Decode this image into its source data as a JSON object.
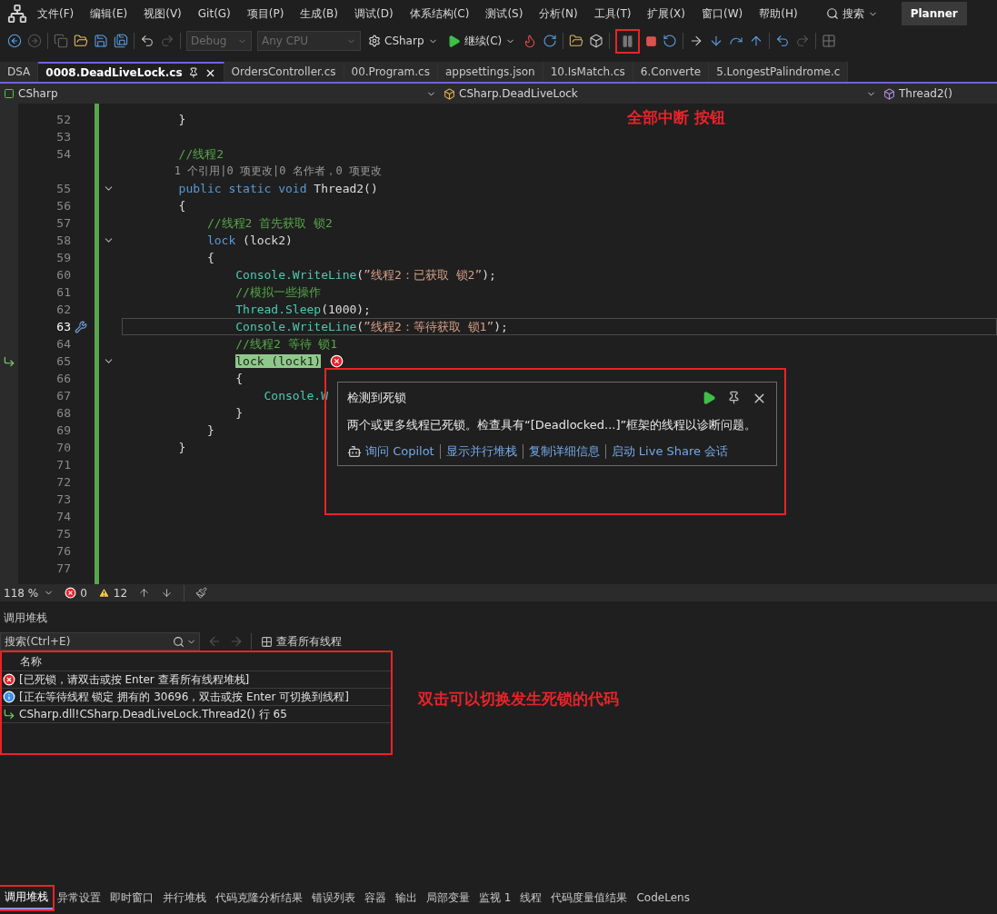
{
  "menu": {
    "items": [
      "文件(F)",
      "编辑(E)",
      "视图(V)",
      "Git(G)",
      "项目(P)",
      "生成(B)",
      "调试(D)",
      "体系结构(C)",
      "测试(S)",
      "分析(N)",
      "工具(T)",
      "扩展(X)",
      "窗口(W)",
      "帮助(H)"
    ],
    "search": "搜索",
    "account_button": "Planner"
  },
  "toolbar": {
    "configuration": {
      "value": "Debug",
      "disabled": true
    },
    "platform": {
      "value": "Any CPU",
      "disabled": true
    },
    "startup_project": "CSharp",
    "continue_button": "继续(C)",
    "break_all": {
      "annotated": true,
      "note": "全部中断 按钮"
    }
  },
  "tabs": [
    {
      "label": "DSA",
      "selected": false
    },
    {
      "label": "0008.DeadLiveLock.cs",
      "selected": true
    },
    {
      "label": "OrdersController.cs",
      "selected": false
    },
    {
      "label": "00.Program.cs",
      "selected": false
    },
    {
      "label": "appsettings.json",
      "selected": false
    },
    {
      "label": "10.IsMatch.cs",
      "selected": false
    },
    {
      "label": "6.Converte",
      "selected": false
    },
    {
      "label": "5.LongestPalindrome.c",
      "selected": false
    }
  ],
  "navigation": {
    "project": "CSharp",
    "type": "CSharp.DeadLiveLock",
    "member": "Thread2()"
  },
  "code_lines": [
    {
      "number": "52",
      "fold": false,
      "caret": false,
      "quick_action": false,
      "current_thread": false,
      "error": false,
      "segments": [
        {
          "kind": "plain",
          "text": "        }"
        }
      ]
    },
    {
      "number": "53",
      "fold": false,
      "caret": false,
      "quick_action": false,
      "current_thread": false,
      "error": false
    },
    {
      "number": "54",
      "fold": false,
      "caret": false,
      "quick_action": false,
      "current_thread": false,
      "error": false,
      "segments": [
        {
          "kind": "comment",
          "text": "        //线程2"
        }
      ]
    },
    {
      "kind": "codelens",
      "text": "        1 个引用|0 项更改|0 名作者，0 项更改"
    },
    {
      "number": "55",
      "fold": true,
      "caret": false,
      "quick_action": false,
      "current_thread": false,
      "error": false,
      "segments": [
        {
          "kind": "keyword",
          "text": "        public static void "
        },
        {
          "kind": "plain",
          "text": "Thread2()"
        }
      ]
    },
    {
      "number": "56",
      "fold": false,
      "caret": false,
      "quick_action": false,
      "current_thread": false,
      "error": false,
      "segments": [
        {
          "kind": "plain",
          "text": "        {"
        }
      ]
    },
    {
      "number": "57",
      "fold": false,
      "caret": false,
      "quick_action": false,
      "current_thread": false,
      "error": false,
      "segments": [
        {
          "kind": "comment",
          "text": "            //线程2 首先获取 锁2"
        }
      ]
    },
    {
      "number": "58",
      "fold": true,
      "caret": false,
      "quick_action": false,
      "current_thread": false,
      "error": false,
      "segments": [
        {
          "kind": "keyword",
          "text": "            lock"
        },
        {
          "kind": "plain",
          "text": " (lock2)"
        }
      ]
    },
    {
      "number": "59",
      "fold": false,
      "caret": false,
      "quick_action": false,
      "current_thread": false,
      "error": false,
      "segments": [
        {
          "kind": "plain",
          "text": "            {"
        }
      ]
    },
    {
      "number": "60",
      "fold": false,
      "caret": false,
      "quick_action": false,
      "current_thread": false,
      "error": false,
      "segments": [
        {
          "kind": "type",
          "text": "                Console.WriteLine"
        },
        {
          "kind": "plain",
          "text": "("
        },
        {
          "kind": "string",
          "text": "”线程2：已获取 锁2”"
        },
        {
          "kind": "plain",
          "text": ");"
        }
      ]
    },
    {
      "number": "61",
      "fold": false,
      "caret": false,
      "quick_action": false,
      "current_thread": false,
      "error": false,
      "segments": [
        {
          "kind": "comment",
          "text": "                //模拟一些操作"
        }
      ]
    },
    {
      "number": "62",
      "fold": false,
      "caret": false,
      "quick_action": false,
      "current_thread": false,
      "error": false,
      "segments": [
        {
          "kind": "type",
          "text": "                Thread.Sleep"
        },
        {
          "kind": "plain",
          "text": "(1000);"
        }
      ]
    },
    {
      "number": "63",
      "fold": false,
      "caret": true,
      "quick_action": true,
      "current_thread": false,
      "error": false,
      "segments": [
        {
          "kind": "type",
          "text": "                Console.WriteLine"
        },
        {
          "kind": "plain",
          "text": "("
        },
        {
          "kind": "string",
          "text": "”线程2：等待获取 锁1”"
        },
        {
          "kind": "plain",
          "text": ");"
        }
      ]
    },
    {
      "number": "64",
      "fold": false,
      "caret": false,
      "quick_action": false,
      "current_thread": false,
      "error": false,
      "segments": [
        {
          "kind": "comment",
          "text": "                //线程2 等待 锁1"
        }
      ]
    },
    {
      "number": "65",
      "fold": true,
      "caret": false,
      "quick_action": false,
      "current_thread": true,
      "error": true,
      "segments": [
        {
          "kind": "highlight",
          "text": "                lock (lock1)"
        }
      ]
    },
    {
      "number": "66",
      "fold": false,
      "caret": false,
      "quick_action": false,
      "current_thread": false,
      "error": false,
      "segments": [
        {
          "kind": "plain",
          "text": "                {"
        }
      ]
    },
    {
      "number": "67",
      "fold": false,
      "caret": false,
      "quick_action": false,
      "current_thread": false,
      "error": false,
      "segments": [
        {
          "kind": "type",
          "text": "                    Console.W"
        }
      ]
    },
    {
      "number": "68",
      "fold": false,
      "caret": false,
      "quick_action": false,
      "current_thread": false,
      "error": false,
      "segments": [
        {
          "kind": "plain",
          "text": "                }"
        }
      ]
    },
    {
      "number": "69",
      "fold": false,
      "caret": false,
      "quick_action": false,
      "current_thread": false,
      "error": false,
      "segments": [
        {
          "kind": "plain",
          "text": "            }"
        }
      ]
    },
    {
      "number": "70",
      "fold": false,
      "caret": false,
      "quick_action": false,
      "current_thread": false,
      "error": false,
      "segments": [
        {
          "kind": "plain",
          "text": "        }"
        }
      ]
    },
    {
      "number": "71",
      "fold": false,
      "caret": false,
      "quick_action": false,
      "current_thread": false,
      "error": false
    },
    {
      "number": "72",
      "fold": false,
      "caret": false,
      "quick_action": false,
      "current_thread": false,
      "error": false
    },
    {
      "number": "73",
      "fold": false,
      "caret": false,
      "quick_action": false,
      "current_thread": false,
      "error": false
    },
    {
      "number": "74",
      "fold": false,
      "caret": false,
      "quick_action": false,
      "current_thread": false,
      "error": false
    },
    {
      "number": "75",
      "fold": false,
      "caret": false,
      "quick_action": false,
      "current_thread": false,
      "error": false
    },
    {
      "number": "76",
      "fold": false,
      "caret": false,
      "quick_action": false,
      "current_thread": false,
      "error": false
    },
    {
      "number": "77",
      "fold": false,
      "caret": false,
      "quick_action": false,
      "current_thread": false,
      "error": false
    }
  ],
  "exception_popup": {
    "title": "检测到死锁",
    "message": "两个或更多线程已死锁。检查具有“[Deadlocked...]”框架的线程以诊断问题。",
    "links": [
      "询问 Copilot",
      "显示并行堆栈",
      "复制详细信息",
      "启动 Live Share 会话"
    ],
    "annotated": true
  },
  "editor_status": {
    "zoom": "118 %",
    "errors": "0",
    "warnings": "12"
  },
  "call_stack": {
    "title": "调用堆栈",
    "search": {
      "placeholder": "搜索(Ctrl+E)"
    },
    "view_threads_button": "查看所有线程",
    "column": "名称",
    "rows": [
      {
        "kind": "error",
        "text": "[已死锁，请双击或按 Enter 查看所有线程堆栈]"
      },
      {
        "kind": "info",
        "text": "[正在等待线程 锁定 拥有的 30696，双击或按 Enter 可切换到线程]"
      },
      {
        "kind": "frame",
        "text": "CSharp.dll!CSharp.DeadLiveLock.Thread2() 行 65"
      }
    ],
    "annotated": true,
    "note": "双击可以切换发生死锁的代码"
  },
  "bottom_tabs": [
    {
      "label": "调用堆栈",
      "selected": true,
      "annotated": true
    },
    {
      "label": "异常设置",
      "selected": false,
      "annotated": false
    },
    {
      "label": "即时窗口",
      "selected": false,
      "annotated": false
    },
    {
      "label": "并行堆栈",
      "selected": false,
      "annotated": false
    },
    {
      "label": "代码克隆分析结果",
      "selected": false,
      "annotated": false
    },
    {
      "label": "错误列表",
      "selected": false,
      "annotated": false
    },
    {
      "label": "容器",
      "selected": false,
      "annotated": false
    },
    {
      "label": "输出",
      "selected": false,
      "annotated": false
    },
    {
      "label": "局部变量",
      "selected": false,
      "annotated": false
    },
    {
      "label": "监视 1",
      "selected": false,
      "annotated": false
    },
    {
      "label": "线程",
      "selected": false,
      "annotated": false
    },
    {
      "label": "代码度量值结果",
      "selected": false,
      "annotated": false
    },
    {
      "label": "CodeLens",
      "selected": false,
      "annotated": false
    }
  ]
}
